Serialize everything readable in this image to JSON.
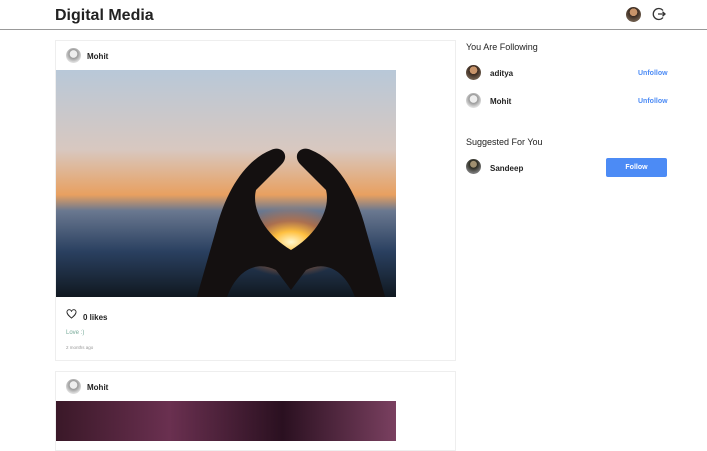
{
  "header": {
    "title": "Digital Media"
  },
  "posts": [
    {
      "author": "Mohit",
      "likes": "0 likes",
      "caption": "Love :)",
      "time": "2 months ago"
    },
    {
      "author": "Mohit"
    }
  ],
  "sidebar": {
    "following_title": "You Are Following",
    "following": [
      {
        "name": "aditya",
        "action": "Unfollow"
      },
      {
        "name": "Mohit",
        "action": "Unfollow"
      }
    ],
    "suggested_title": "Suggested For You",
    "suggested": [
      {
        "name": "Sandeep",
        "action": "Follow"
      }
    ]
  }
}
